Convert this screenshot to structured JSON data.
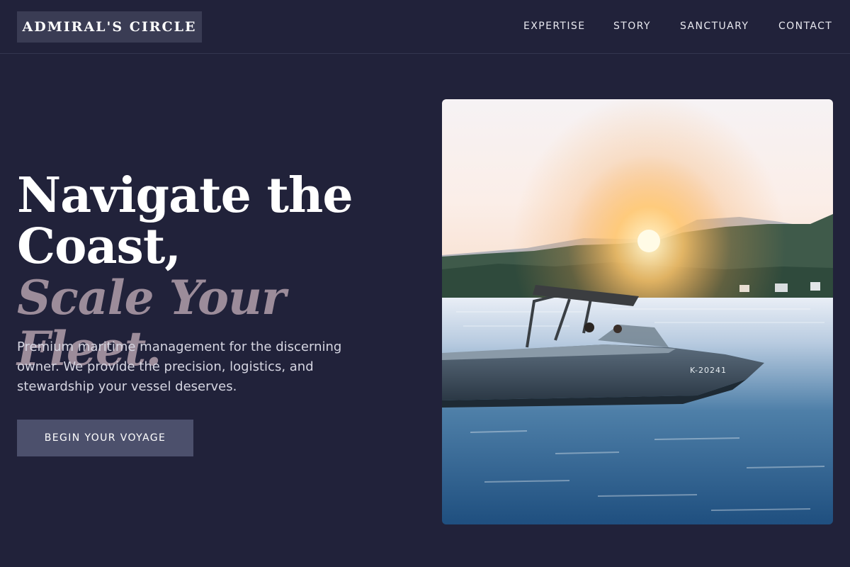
{
  "brand": {
    "name": "ADMIRAL'S CIRCLE"
  },
  "nav": {
    "items": [
      {
        "label": "EXPERTISE"
      },
      {
        "label": "STORY"
      },
      {
        "label": "SANCTUARY"
      },
      {
        "label": "CONTACT"
      }
    ]
  },
  "hero": {
    "title_line1": "Navigate the",
    "title_line2": "Coast,",
    "title_accent": "Scale Your Fleet.",
    "description": "Premium maritime management for the discerning owner. We provide the precision, logistics, and stewardship your vessel deserves.",
    "cta_label": "BEGIN YOUR VOYAGE"
  },
  "image": {
    "hull_registration": "K-20241"
  },
  "colors": {
    "background": "#21223a",
    "logo_bg": "#3a3c54",
    "accent_text": "#9c8c9a",
    "button_bg": "#4c506c"
  }
}
